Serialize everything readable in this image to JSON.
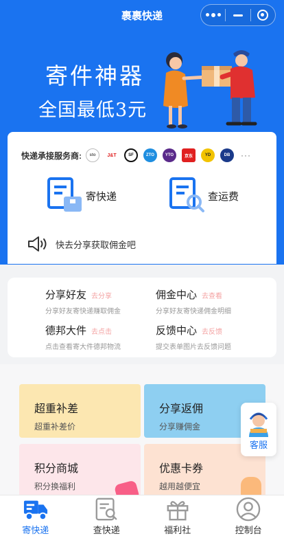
{
  "app": {
    "title": "裹裹快递"
  },
  "banner": {
    "line1": "寄件神器",
    "line2": "全国最低3元"
  },
  "carriers": {
    "label": "快递承接服务商:",
    "logos": [
      {
        "name": "sto",
        "text": "sto",
        "color": "#666666"
      },
      {
        "name": "jt",
        "text": "J&T",
        "color": "#e02020"
      },
      {
        "name": "sf",
        "text": "SF",
        "color": "#111111"
      },
      {
        "name": "zto",
        "text": "ZTO",
        "color": "#1f8ee0"
      },
      {
        "name": "yto",
        "text": "YTO",
        "color": "#5a2a8a"
      },
      {
        "name": "jd",
        "text": "京东",
        "color": "#e02020"
      },
      {
        "name": "yunda",
        "text": "YD",
        "color": "#f2c300"
      },
      {
        "name": "db",
        "text": "DB",
        "color": "#1a3a8a"
      }
    ],
    "more": "···"
  },
  "actions": {
    "send": "寄快递",
    "query": "查运费"
  },
  "notice": {
    "text": "快去分享获取佣金吧"
  },
  "links": [
    {
      "title": "分享好友",
      "tag": "去分享",
      "sub": "分享好友寄快递赚取佣金"
    },
    {
      "title": "佣金中心",
      "tag": "去查看",
      "sub": "分享好友寄快递佣金明细"
    },
    {
      "title": "德邦大件",
      "tag": "去点击",
      "sub": "点击查看寄大件德邦物流"
    },
    {
      "title": "反馈中心",
      "tag": "去反馈",
      "sub": "提交表单图片去反馈问题"
    }
  ],
  "services": [
    {
      "title": "超重补差",
      "sub": "超重补差价"
    },
    {
      "title": "分享返佣",
      "sub": "分享赚佣金"
    },
    {
      "title": "积分商城",
      "sub": "积分换福利"
    },
    {
      "title": "优惠卡券",
      "sub": "越用越便宜"
    }
  ],
  "kefu": {
    "label": "客服"
  },
  "tabs": [
    {
      "label": "寄快递"
    },
    {
      "label": "查快递"
    },
    {
      "label": "福利社"
    },
    {
      "label": "控制台"
    }
  ],
  "colors": {
    "primary": "#1a73f0",
    "tag": "#f4a3a3"
  }
}
